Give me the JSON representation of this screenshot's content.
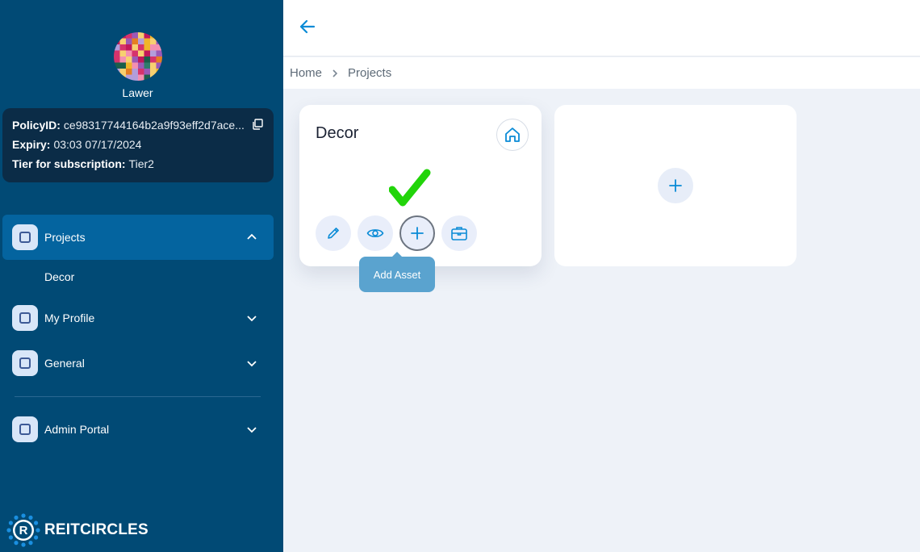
{
  "user": {
    "name": "Lawer"
  },
  "policy": {
    "id_label": "PolicyID:",
    "id_value": "ce98317744164b2a9f93eff2d7ace...",
    "expiry_label": "Expiry:",
    "expiry_value": "03:03 07/17/2024",
    "tier_label": "Tier for subscription:",
    "tier_value": "Tier2"
  },
  "nav": {
    "projects": "Projects",
    "projects_sub": "Decor",
    "my_profile": "My Profile",
    "general": "General",
    "admin_portal": "Admin Portal"
  },
  "brand": {
    "name": "REITCIRCLES"
  },
  "breadcrumb": {
    "home": "Home",
    "current": "Projects"
  },
  "project_card": {
    "title": "Decor",
    "tooltip": "Add Asset"
  },
  "colors": {
    "sidebar": "#014a75",
    "accent": "#0a8bd6",
    "active_nav": "#04649f",
    "check": "#22d40a"
  }
}
